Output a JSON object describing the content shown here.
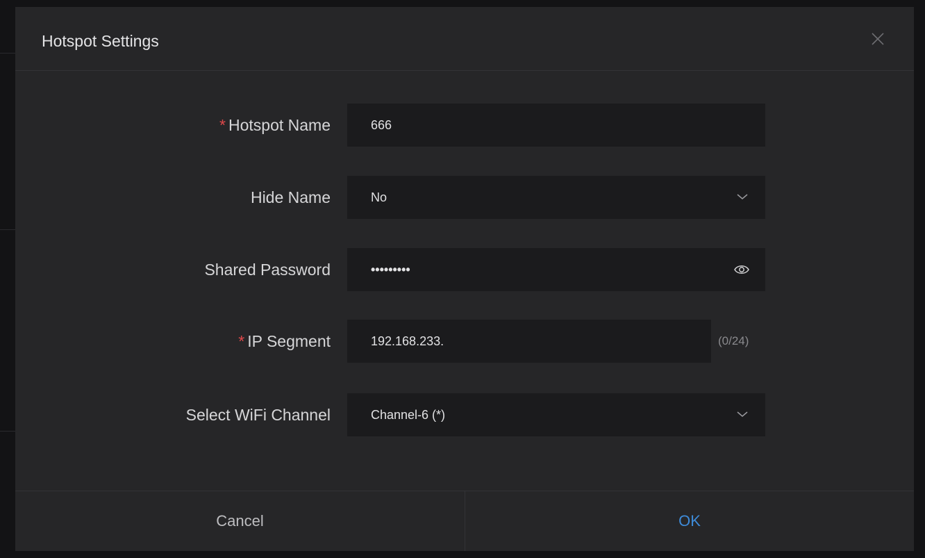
{
  "dialog": {
    "title": "Hotspot Settings",
    "close_icon": "close-icon"
  },
  "form": {
    "hotspot_name": {
      "required": "*",
      "label": "Hotspot Name",
      "value": "666"
    },
    "hide_name": {
      "label": "Hide Name",
      "value": "No",
      "icon": "chevron-down-icon"
    },
    "shared_password": {
      "label": "Shared Password",
      "value": "•••••••••",
      "icon": "eye-icon"
    },
    "ip_segment": {
      "required": "*",
      "label": "IP Segment",
      "value": "192.168.233.",
      "counter": "(0/24)"
    },
    "wifi_channel": {
      "label": "Select WiFi Channel",
      "value": "Channel-6 (*)",
      "icon": "chevron-down-icon"
    }
  },
  "footer": {
    "cancel_label": "Cancel",
    "ok_label": "OK"
  },
  "colors": {
    "dialog_bg": "#262628",
    "field_bg": "#1b1b1d",
    "required": "#e0484a",
    "accent": "#3e8bd9"
  }
}
